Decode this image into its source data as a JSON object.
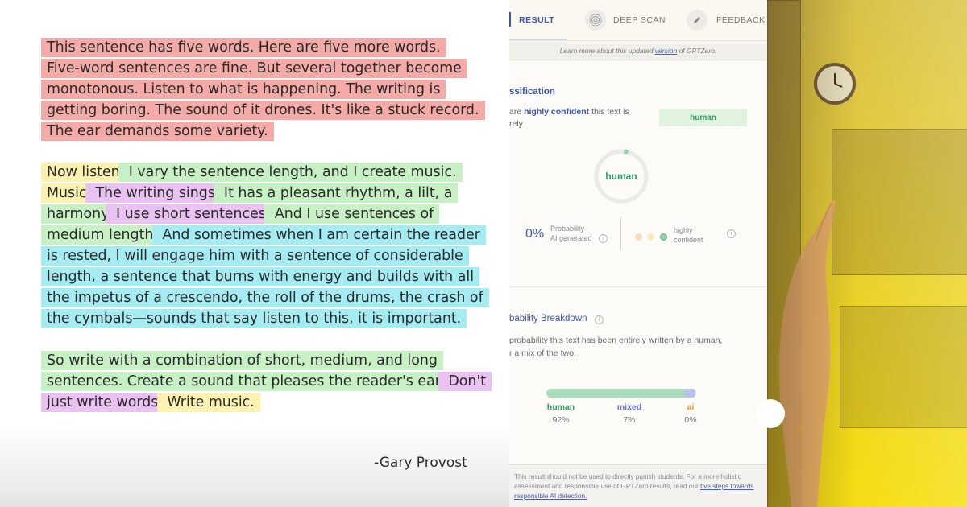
{
  "article": {
    "para1": [
      [
        {
          "t": "This sentence has five words. Here are five more words.",
          "c": "red"
        }
      ],
      [
        {
          "t": "Five-word sentences are fine. But several together become",
          "c": "red"
        }
      ],
      [
        {
          "t": "monotonous. Listen to what is happening. The writing is",
          "c": "red"
        }
      ],
      [
        {
          "t": "getting boring. The sound of it drones. It's like a stuck record.",
          "c": "red"
        }
      ],
      [
        {
          "t": "The ear demands some variety.",
          "c": "red"
        }
      ]
    ],
    "para2": [
      [
        {
          "t": "Now listen.",
          "c": "yel"
        },
        {
          "t": " I vary the sentence length, and I create music.",
          "c": "grn"
        }
      ],
      [
        {
          "t": "Music.",
          "c": "yel"
        },
        {
          "t": " The writing sings.",
          "c": "pur"
        },
        {
          "t": " It has a pleasant rhythm, a lilt, a",
          "c": "grn"
        }
      ],
      [
        {
          "t": "harmony.",
          "c": "grn"
        },
        {
          "t": " I use short sentences.",
          "c": "pur"
        },
        {
          "t": " And I use sentences of",
          "c": "grn"
        }
      ],
      [
        {
          "t": "medium length.",
          "c": "grn"
        },
        {
          "t": " And sometimes when I am certain the reader",
          "c": "cyn"
        }
      ],
      [
        {
          "t": "is rested, I will engage him with a sentence of considerable",
          "c": "cyn"
        }
      ],
      [
        {
          "t": "length, a sentence that burns with energy and builds with all",
          "c": "cyn"
        }
      ],
      [
        {
          "t": "the impetus of a crescendo, the roll of the drums, the crash of",
          "c": "cyn"
        }
      ],
      [
        {
          "t": "the cymbals—sounds that say listen to this, it is important.",
          "c": "cyn"
        }
      ]
    ],
    "para3": [
      [
        {
          "t": "So write with a combination of short, medium, and long",
          "c": "grn"
        }
      ],
      [
        {
          "t": "sentences. Create a sound that pleases the reader's ear.",
          "c": "grn"
        },
        {
          "t": " Don't",
          "c": "pur"
        }
      ],
      [
        {
          "t": "just write words.",
          "c": "pur"
        },
        {
          "t": " Write music.",
          "c": "yel"
        }
      ]
    ],
    "attribution": "-Gary Provost"
  },
  "panel": {
    "tabs": {
      "result": "RESULT",
      "deep_scan": "DEEP SCAN",
      "feedback": "FEEDBACK"
    },
    "learn": {
      "before": "Learn more about this updated ",
      "link": "version",
      "after": " of GPTZero."
    },
    "classification": {
      "heading": "ssification",
      "conf_prefix": "are ",
      "conf_bold": "highly confident",
      "conf_suffix": " this text is",
      "conf_line2": "rely",
      "pill": "human",
      "ring_label": "human",
      "ring_fraction": 0.03
    },
    "prob": {
      "value": "0%",
      "label1": "Probability",
      "label2": "AI generated"
    },
    "confidence": {
      "label1": "highly",
      "label2": "confident"
    },
    "breakdown": {
      "heading": "bability Breakdown",
      "desc1": " probability this text has been entirely written by a human,",
      "desc2": "r a mix of the two.",
      "segments": [
        {
          "name": "human",
          "value": "92%",
          "fraction": 0.92
        },
        {
          "name": "mixed",
          "value": "7%",
          "fraction": 0.07
        },
        {
          "name": "ai",
          "value": "0%",
          "fraction": 0.0
        }
      ]
    },
    "footer": {
      "text": "This result should not be used to directly punish students. For a more holistic assessment and responsible use of GPTZero results, read our ",
      "link": "five steps towards responsible AI detection."
    }
  },
  "colors": {
    "red": "#f4aaa6",
    "yellow": "#fbf1b0",
    "purple": "#eac2f1",
    "green": "#c7f0c4",
    "cyan": "#a5ebf2",
    "brand_blue": "#3d57a8",
    "human_green": "#2e9e61",
    "mixed_blue": "#5f77c9",
    "ai_orange": "#e59c1c"
  }
}
